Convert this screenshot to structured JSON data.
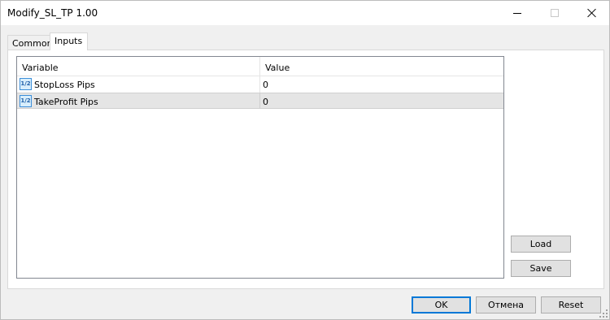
{
  "window": {
    "title": "Modify_SL_TP 1.00"
  },
  "tabs": [
    {
      "label": "Common",
      "active": false
    },
    {
      "label": "Inputs",
      "active": true
    }
  ],
  "inputs_table": {
    "columns": [
      "Variable",
      "Value"
    ],
    "rows": [
      {
        "icon": "number-icon",
        "icon_text": "1/2",
        "variable": "StopLoss Pips",
        "value": "0"
      },
      {
        "icon": "number-icon",
        "icon_text": "1/2",
        "variable": "TakeProfit Pips",
        "value": "0",
        "selected": true
      }
    ]
  },
  "side_buttons": {
    "load_label": "Load",
    "save_label": "Save"
  },
  "footer_buttons": {
    "ok_label": "OK",
    "cancel_label": "Отмена",
    "reset_label": "Reset"
  },
  "colors": {
    "accent": "#0078d7",
    "selected_row": "#e5e5e5",
    "icon_blue": "#3b8ed9"
  }
}
